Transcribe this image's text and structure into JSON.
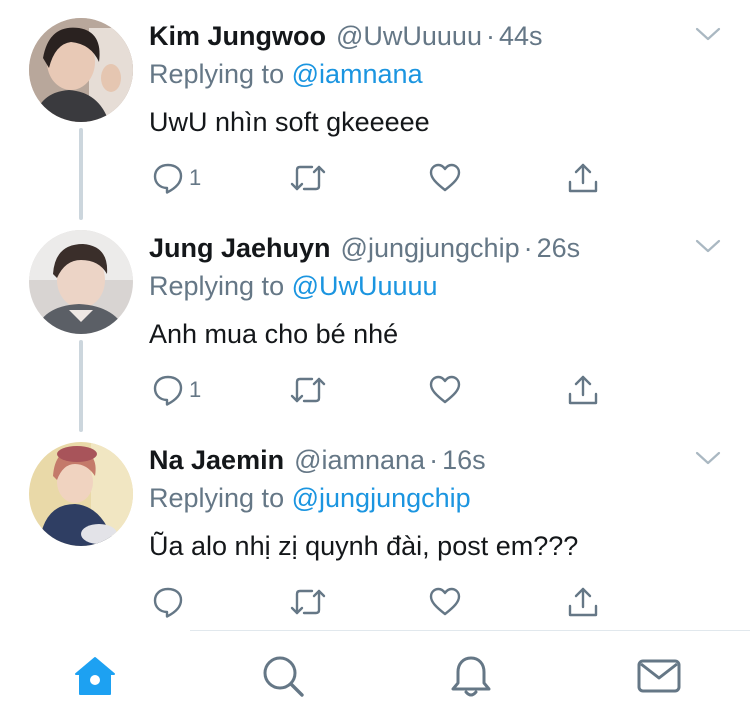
{
  "colors": {
    "link": "#1b95e0",
    "primary_text": "#14171a",
    "secondary_text": "#657786",
    "thread_line": "#ccd6dd",
    "active_tab": "#1da1f2"
  },
  "tweets": [
    {
      "name": "Kim Jungwoo",
      "handle": "@UwUuuuu",
      "dot": "·",
      "time": "44s",
      "replying_prefix": "Replying to",
      "replying_to": "@iamnana",
      "text": "UwU nhìn soft gkeeeee",
      "actions": {
        "reply_count": "1",
        "retweet_count": "",
        "like_count": ""
      }
    },
    {
      "name": "Jung Jaehuyn",
      "handle": "@jungjungchip",
      "dot": "·",
      "time": "26s",
      "replying_prefix": "Replying to",
      "replying_to": "@UwUuuuu",
      "text": "Anh mua cho bé nhé",
      "actions": {
        "reply_count": "1",
        "retweet_count": "",
        "like_count": ""
      }
    },
    {
      "name": "Na Jaemin",
      "handle": "@iamnana",
      "dot": "·",
      "time": "16s",
      "replying_prefix": "Replying to",
      "replying_to": "@jungjungchip",
      "text": "Ũa alo nhị zị quynh đài, post em???",
      "actions": {
        "reply_count": "",
        "retweet_count": "",
        "like_count": ""
      }
    }
  ],
  "icons": {
    "reply": "reply-icon",
    "retweet": "retweet-icon",
    "like": "heart-icon",
    "share": "share-icon",
    "chevron": "chevron-down-icon"
  },
  "tabbar": {
    "items": [
      "home-icon",
      "search-icon",
      "notifications-icon",
      "messages-icon"
    ],
    "active": "home"
  }
}
